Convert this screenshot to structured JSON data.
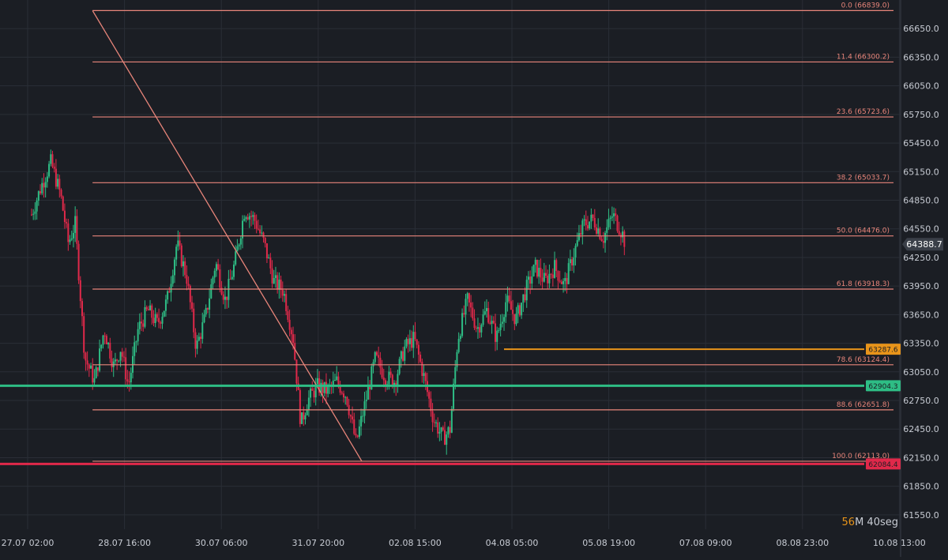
{
  "chart_data": {
    "type": "candlestick",
    "colors": {
      "background": "#1b1e24",
      "grid": "#2a2e36",
      "axis_text": "#c8ccd4",
      "up": "#2ebd85",
      "down": "#e0294a",
      "fib": "#e8857a",
      "trendline": "#e8857a",
      "orange_level": "#e8941a",
      "green_level": "#2ebd85",
      "red_level": "#e0294a",
      "current_price_bg": "#3a3f48",
      "timer_number": "#e8941a"
    },
    "ylim": [
      61400,
      66950
    ],
    "y_ticks": [
      "66650.0",
      "66350.0",
      "66050.0",
      "65750.0",
      "65450.0",
      "65150.0",
      "64850.0",
      "64550.0",
      "64250.0",
      "63950.0",
      "63650.0",
      "63350.0",
      "63050.0",
      "62750.0",
      "62450.0",
      "62150.0",
      "61850.0",
      "61550.0"
    ],
    "x_ticks": [
      "27.07 02:00",
      "28.07 16:00",
      "30.07 06:00",
      "31.07 20:00",
      "02.08 15:00",
      "04.08 05:00",
      "05.08 19:00",
      "07.08 09:00",
      "08.08 23:00",
      "10.08 13:00"
    ],
    "fib_levels": [
      {
        "label": "0.0 (66839.0)",
        "value": 66839.0
      },
      {
        "label": "11.4 (66300.2)",
        "value": 66300.2
      },
      {
        "label": "23.6 (65723.6)",
        "value": 65723.6
      },
      {
        "label": "38.2 (65033.7)",
        "value": 65033.7
      },
      {
        "label": "50.0 (64476.0)",
        "value": 64476.0
      },
      {
        "label": "61.8 (63918.3)",
        "value": 63918.3
      },
      {
        "label": "78.6 (63124.4)",
        "value": 63124.4
      },
      {
        "label": "88.6 (62651.8)",
        "value": 62651.8
      },
      {
        "label": "100.0 (62113.0)",
        "value": 62113.0
      }
    ],
    "price_lines": [
      {
        "name": "orange",
        "value": 63287.6,
        "label": "63287.6"
      },
      {
        "name": "green",
        "value": 62904.3,
        "label": "62904.3"
      },
      {
        "name": "red",
        "value": 62084.4,
        "label": "62084.4"
      }
    ],
    "current_price": {
      "value": 64388.7,
      "label": "64388.7"
    },
    "trendline": {
      "from_tick": 0.67,
      "from_price": 66839.0,
      "to_tick": 3.45,
      "to_price": 62113.0
    },
    "price_path": [
      [
        0.0,
        64700
      ],
      [
        0.1,
        65000
      ],
      [
        0.2,
        65250
      ],
      [
        0.3,
        64900
      ],
      [
        0.38,
        64400
      ],
      [
        0.45,
        64600
      ],
      [
        0.55,
        63200
      ],
      [
        0.65,
        62950
      ],
      [
        0.75,
        63500
      ],
      [
        0.85,
        63100
      ],
      [
        0.92,
        63300
      ],
      [
        1.0,
        62900
      ],
      [
        1.1,
        63500
      ],
      [
        1.2,
        63700
      ],
      [
        1.3,
        63550
      ],
      [
        1.4,
        63800
      ],
      [
        1.5,
        64400
      ],
      [
        1.6,
        64050
      ],
      [
        1.7,
        63300
      ],
      [
        1.8,
        63650
      ],
      [
        1.9,
        64200
      ],
      [
        2.0,
        63800
      ],
      [
        2.1,
        64200
      ],
      [
        2.2,
        64750
      ],
      [
        2.3,
        64650
      ],
      [
        2.4,
        64400
      ],
      [
        2.5,
        64000
      ],
      [
        2.6,
        63900
      ],
      [
        2.7,
        63400
      ],
      [
        2.78,
        62500
      ],
      [
        2.85,
        62750
      ],
      [
        2.95,
        62900
      ],
      [
        3.05,
        62850
      ],
      [
        3.15,
        62950
      ],
      [
        3.25,
        62800
      ],
      [
        3.35,
        62300
      ],
      [
        3.45,
        62750
      ],
      [
        3.55,
        63200
      ],
      [
        3.65,
        63000
      ],
      [
        3.75,
        62950
      ],
      [
        3.85,
        63300
      ],
      [
        3.95,
        63400
      ],
      [
        4.05,
        63000
      ],
      [
        4.15,
        62550
      ],
      [
        4.25,
        62350
      ],
      [
        4.32,
        62450
      ],
      [
        4.4,
        63400
      ],
      [
        4.5,
        63800
      ],
      [
        4.6,
        63500
      ],
      [
        4.7,
        63700
      ],
      [
        4.8,
        63400
      ],
      [
        4.9,
        63800
      ],
      [
        5.0,
        63600
      ],
      [
        5.1,
        63900
      ],
      [
        5.2,
        64150
      ],
      [
        5.3,
        64000
      ],
      [
        5.4,
        64150
      ],
      [
        5.5,
        63950
      ],
      [
        5.6,
        64300
      ],
      [
        5.7,
        64600
      ],
      [
        5.8,
        64650
      ],
      [
        5.9,
        64450
      ],
      [
        6.0,
        64700
      ],
      [
        6.1,
        64500
      ],
      [
        6.13,
        64390
      ]
    ]
  },
  "timer": {
    "number_part": "56",
    "text_part": "M 40seg"
  }
}
